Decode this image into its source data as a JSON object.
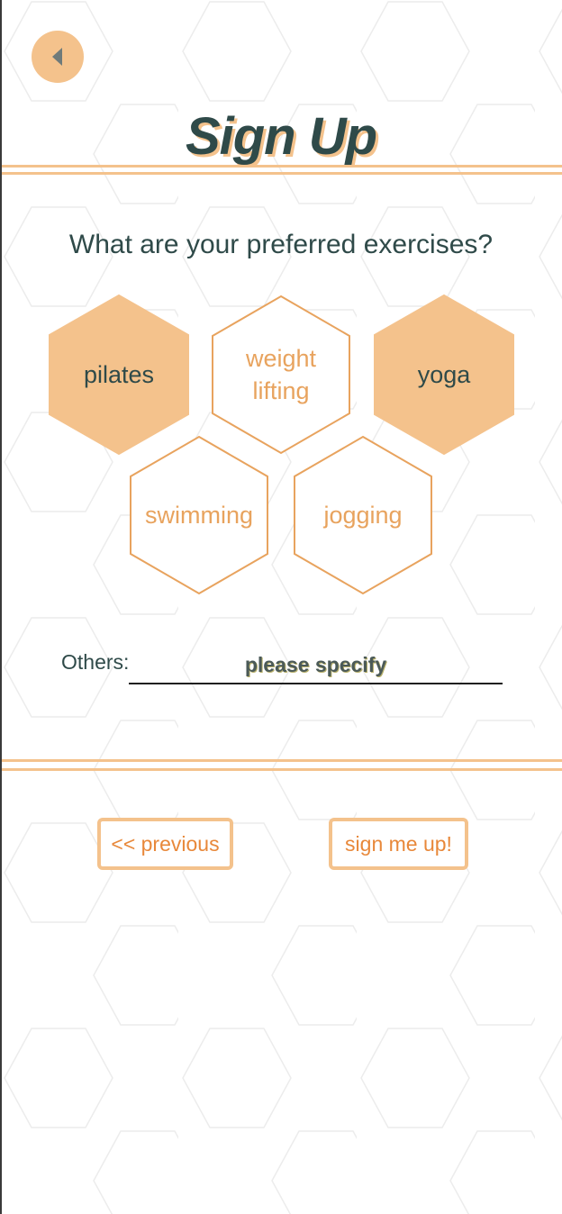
{
  "header": {
    "back_icon": "caret-left-icon",
    "title": "Sign Up"
  },
  "form": {
    "question": "What are your preferred exercises?",
    "exercises": [
      {
        "label": "pilates",
        "selected": true
      },
      {
        "label": "weight\nlifting",
        "selected": false
      },
      {
        "label": "yoga",
        "selected": true
      },
      {
        "label": "swimming",
        "selected": false
      },
      {
        "label": "jogging",
        "selected": false
      }
    ],
    "others_label": "Others:",
    "others_value": "",
    "others_placeholder": "please specify"
  },
  "footer": {
    "previous_label": "<< previous",
    "submit_label": "sign me up!"
  },
  "colors": {
    "accent": "#f4c28c",
    "accent_text": "#e8a35e",
    "button_text": "#e8883a",
    "dark_text": "#2f4a49",
    "back_icon": "#6e7a7a"
  }
}
